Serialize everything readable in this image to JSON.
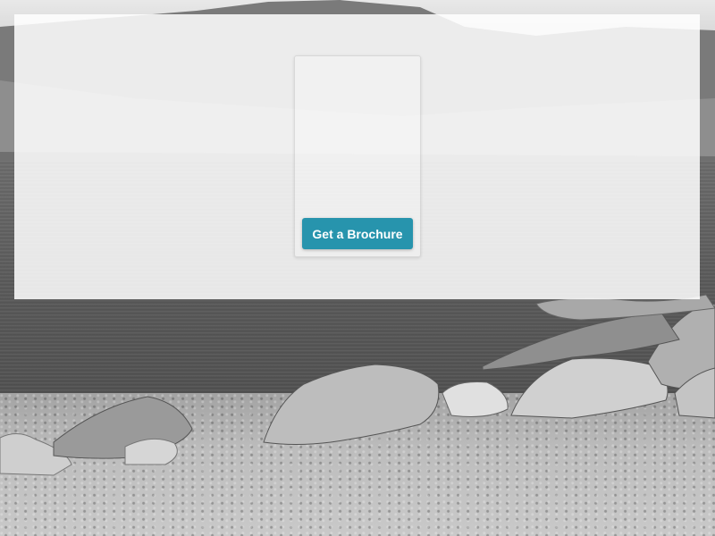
{
  "hero": {
    "cta_label": "Get a Brochure"
  },
  "colors": {
    "cta_background": "#2794ad",
    "cta_text": "#ffffff",
    "overlay": "rgba(255,255,255,0.86)"
  }
}
